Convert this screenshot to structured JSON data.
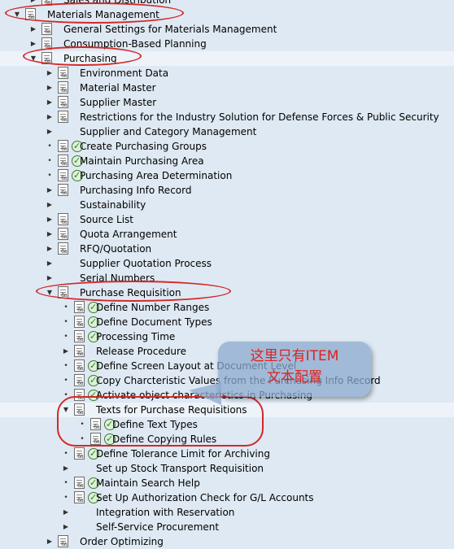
{
  "tree": {
    "items": [
      {
        "label": "Sales and Distribution"
      },
      {
        "label": "Materials Management"
      },
      {
        "label": "General Settings for Materials Management"
      },
      {
        "label": "Consumption-Based Planning"
      },
      {
        "label": "Purchasing"
      },
      {
        "label": "Environment Data"
      },
      {
        "label": "Material Master"
      },
      {
        "label": "Supplier Master"
      },
      {
        "label": "Restrictions for the Industry Solution for Defense Forces & Public Security"
      },
      {
        "label": "Supplier and Category Management"
      },
      {
        "label": "Create Purchasing Groups"
      },
      {
        "label": "Maintain Purchasing Area"
      },
      {
        "label": "Purchasing Area Determination"
      },
      {
        "label": "Purchasing Info Record"
      },
      {
        "label": "Sustainability"
      },
      {
        "label": "Source List"
      },
      {
        "label": "Quota Arrangement"
      },
      {
        "label": "RFQ/Quotation"
      },
      {
        "label": "Supplier Quotation Process"
      },
      {
        "label": "Serial Numbers"
      },
      {
        "label": "Purchase Requisition"
      },
      {
        "label": "Define Number Ranges"
      },
      {
        "label": "Define Document Types"
      },
      {
        "label": "Processing Time"
      },
      {
        "label": "Release Procedure"
      },
      {
        "label": "Define Screen Layout at Document Level"
      },
      {
        "label": "Copy Charcteristic Values from the Purchasing Info Record"
      },
      {
        "label": "Activate object characteristics in Purchasing"
      },
      {
        "label": "Texts for Purchase Requisitions"
      },
      {
        "label": "Define Text Types"
      },
      {
        "label": "Define Copying Rules"
      },
      {
        "label": "Define Tolerance Limit for Archiving"
      },
      {
        "label": "Set up Stock Transport Requisition"
      },
      {
        "label": "Maintain Search Help"
      },
      {
        "label": "Set Up Authorization Check for G/L Accounts"
      },
      {
        "label": "Integration with Reservation"
      },
      {
        "label": "Self-Service Procurement"
      },
      {
        "label": "Order Optimizing"
      }
    ]
  },
  "annotation": {
    "line1": "这里只有ITEM",
    "line2": "文本配置"
  },
  "colors": {
    "background": "#dfe9f3",
    "highlight_oval": "#d42828",
    "callout_text": "#e02020",
    "check_icon": "#1e8a1e"
  },
  "icons": {
    "expanded": "triangle-down-icon",
    "collapsed": "triangle-right-icon",
    "leaf": "bullet-icon",
    "node": "document-glasses-icon",
    "activity": "clock-check-icon"
  }
}
